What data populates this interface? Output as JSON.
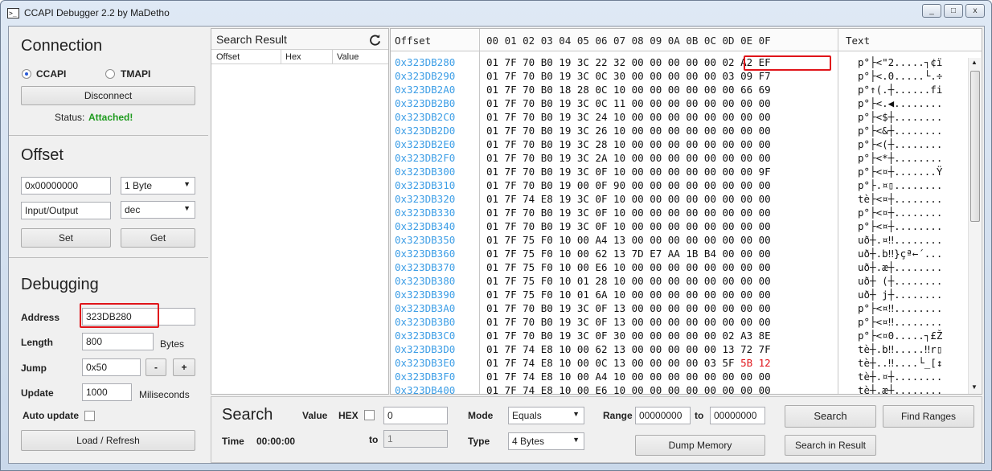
{
  "window": {
    "title": "CCAPI Debugger 2.2 by MaDetho",
    "buttons": [
      "_",
      "□",
      "x"
    ]
  },
  "connection": {
    "title": "Connection",
    "option_ccapi": "CCAPI",
    "option_tmapi": "TMAPI",
    "selected": "CCAPI",
    "disconnect_label": "Disconnect",
    "status_label": "Status:",
    "status_value": "Attached!",
    "status_color": "#1f9b1f"
  },
  "offset": {
    "title": "Offset",
    "offset_value": "0x00000000",
    "size_select": "1 Byte",
    "io_value": "Input/Output",
    "format_select": "dec",
    "set_label": "Set",
    "get_label": "Get"
  },
  "debugging": {
    "title": "Debugging",
    "address_label": "Address",
    "address_value": "323DB280",
    "length_label": "Length",
    "length_value": "800",
    "length_unit": "Bytes",
    "jump_label": "Jump",
    "jump_value": "0x50",
    "jump_minus": "-",
    "jump_plus": "+",
    "update_label": "Update",
    "update_value": "1000",
    "update_unit": "Miliseconds",
    "auto_update_label": "Auto update",
    "auto_update_checked": false,
    "load_label": "Load / Refresh"
  },
  "search_result": {
    "title": "Search Result",
    "refresh_icon": "refresh-icon",
    "columns": [
      "Offset",
      "Hex",
      "Value"
    ]
  },
  "hex_view": {
    "header_offset": "Offset",
    "header_bytes": "00 01 02 03 04 05 06 07 08 09 0A 0B 0C 0D 0E 0F",
    "header_text": "Text",
    "highlight_color": "#e0141a",
    "rows": [
      {
        "offset": "0x323DB280",
        "bytes": "01 7F 70 B0 19 3C 22 32 00 00 00 00 00 02 A2 EF",
        "text": "p°├<\"2.....┐¢ï"
      },
      {
        "offset": "0x323DB290",
        "bytes": "01 7F 70 B0 19 3C 0C 30 00 00 00 00 00 03 09 F7",
        "text": "p°├<.0.....└.÷"
      },
      {
        "offset": "0x323DB2A0",
        "bytes": "01 7F 70 B0 18 28 0C 10 00 00 00 00 00 00 66 69",
        "text": "p°↑(.┼......fi"
      },
      {
        "offset": "0x323DB2B0",
        "bytes": "01 7F 70 B0 19 3C 0C 11 00 00 00 00 00 00 00 00",
        "text": "p°├<.◀........"
      },
      {
        "offset": "0x323DB2C0",
        "bytes": "01 7F 70 B0 19 3C 24 10 00 00 00 00 00 00 00 00",
        "text": "p°├<$┼........"
      },
      {
        "offset": "0x323DB2D0",
        "bytes": "01 7F 70 B0 19 3C 26 10 00 00 00 00 00 00 00 00",
        "text": "p°├<&┼........"
      },
      {
        "offset": "0x323DB2E0",
        "bytes": "01 7F 70 B0 19 3C 28 10 00 00 00 00 00 00 00 00",
        "text": "p°├<(┼........"
      },
      {
        "offset": "0x323DB2F0",
        "bytes": "01 7F 70 B0 19 3C 2A 10 00 00 00 00 00 00 00 00",
        "text": "p°├<*┼........"
      },
      {
        "offset": "0x323DB300",
        "bytes": "01 7F 70 B0 19 3C 0F 10 00 00 00 00 00 00 00 9F",
        "text": "p°├<¤┼.......Ÿ"
      },
      {
        "offset": "0x323DB310",
        "bytes": "01 7F 70 B0 19 00 0F 90 00 00 00 00 00 00 00 00",
        "text": "p°├.¤▯........"
      },
      {
        "offset": "0x323DB320",
        "bytes": "01 7F 74 E8 19 3C 0F 10 00 00 00 00 00 00 00 00",
        "text": "tè├<¤┼........"
      },
      {
        "offset": "0x323DB330",
        "bytes": "01 7F 70 B0 19 3C 0F 10 00 00 00 00 00 00 00 00",
        "text": "p°├<¤┼........"
      },
      {
        "offset": "0x323DB340",
        "bytes": "01 7F 70 B0 19 3C 0F 10 00 00 00 00 00 00 00 00",
        "text": "p°├<¤┼........"
      },
      {
        "offset": "0x323DB350",
        "bytes": "01 7F 75 F0 10 00 A4 13 00 00 00 00 00 00 00 00",
        "text": "uð┼.¤‼........"
      },
      {
        "offset": "0x323DB360",
        "bytes": "01 7F 75 F0 10 00 62 13 7D E7 AA 1B B4 00 00 00",
        "text": "uð┼.b‼}çª←´..."
      },
      {
        "offset": "0x323DB370",
        "bytes": "01 7F 75 F0 10 00 E6 10 00 00 00 00 00 00 00 00",
        "text": "uð┼.æ┼........"
      },
      {
        "offset": "0x323DB380",
        "bytes": "01 7F 75 F0 10 01 28 10 00 00 00 00 00 00 00 00",
        "text": "uð┼ (┼........"
      },
      {
        "offset": "0x323DB390",
        "bytes": "01 7F 75 F0 10 01 6A 10 00 00 00 00 00 00 00 00",
        "text": "uð┼ j┼........"
      },
      {
        "offset": "0x323DB3A0",
        "bytes": "01 7F 70 B0 19 3C 0F 13 00 00 00 00 00 00 00 00",
        "text": "p°├<¤‼........"
      },
      {
        "offset": "0x323DB3B0",
        "bytes": "01 7F 70 B0 19 3C 0F 13 00 00 00 00 00 00 00 00",
        "text": "p°├<¤‼........"
      },
      {
        "offset": "0x323DB3C0",
        "bytes": "01 7F 70 B0 19 3C 0F 30 00 00 00 00 00 02 A3 8E",
        "text": "p°├<¤0.....┐£Ž"
      },
      {
        "offset": "0x323DB3D0",
        "bytes": "01 7F 74 E8 10 00 62 13 00 00 00 00 00 13 72 7F",
        "text": "tè┼.b‼.....‼r▯"
      },
      {
        "offset": "0x323DB3E0",
        "bytes": "01 7F 74 E8 10 00 0C 13 00 00 00 00 03 5F 5B 12",
        "text": "tè┼..‼....└_[↕"
      },
      {
        "offset": "0x323DB3F0",
        "bytes": "01 7F 74 E8 10 00 A4 10 00 00 00 00 00 00 00 00",
        "text": "tè┼.¤┼........"
      },
      {
        "offset": "0x323DB400",
        "bytes": "01 7F 74 E8 10 00 E6 10 00 00 00 00 00 00 00 00",
        "text": "tè┼.æ┼........"
      }
    ]
  },
  "search": {
    "title": "Search",
    "time_label": "Time",
    "time_value": "00:00:00",
    "value_label": "Value",
    "hex_label": "HEX",
    "hex_checked": false,
    "value_input": "0",
    "to_label": "to",
    "to_input": "1",
    "mode_label": "Mode",
    "mode_select": "Equals",
    "type_label": "Type",
    "type_select": "4 Bytes",
    "range_label": "Range",
    "range_from": "00000000",
    "range_to_label": "to",
    "range_to": "00000000",
    "search_button": "Search",
    "find_ranges_button": "Find Ranges",
    "dump_memory_button": "Dump Memory",
    "search_in_result_button": "Search in Result"
  }
}
